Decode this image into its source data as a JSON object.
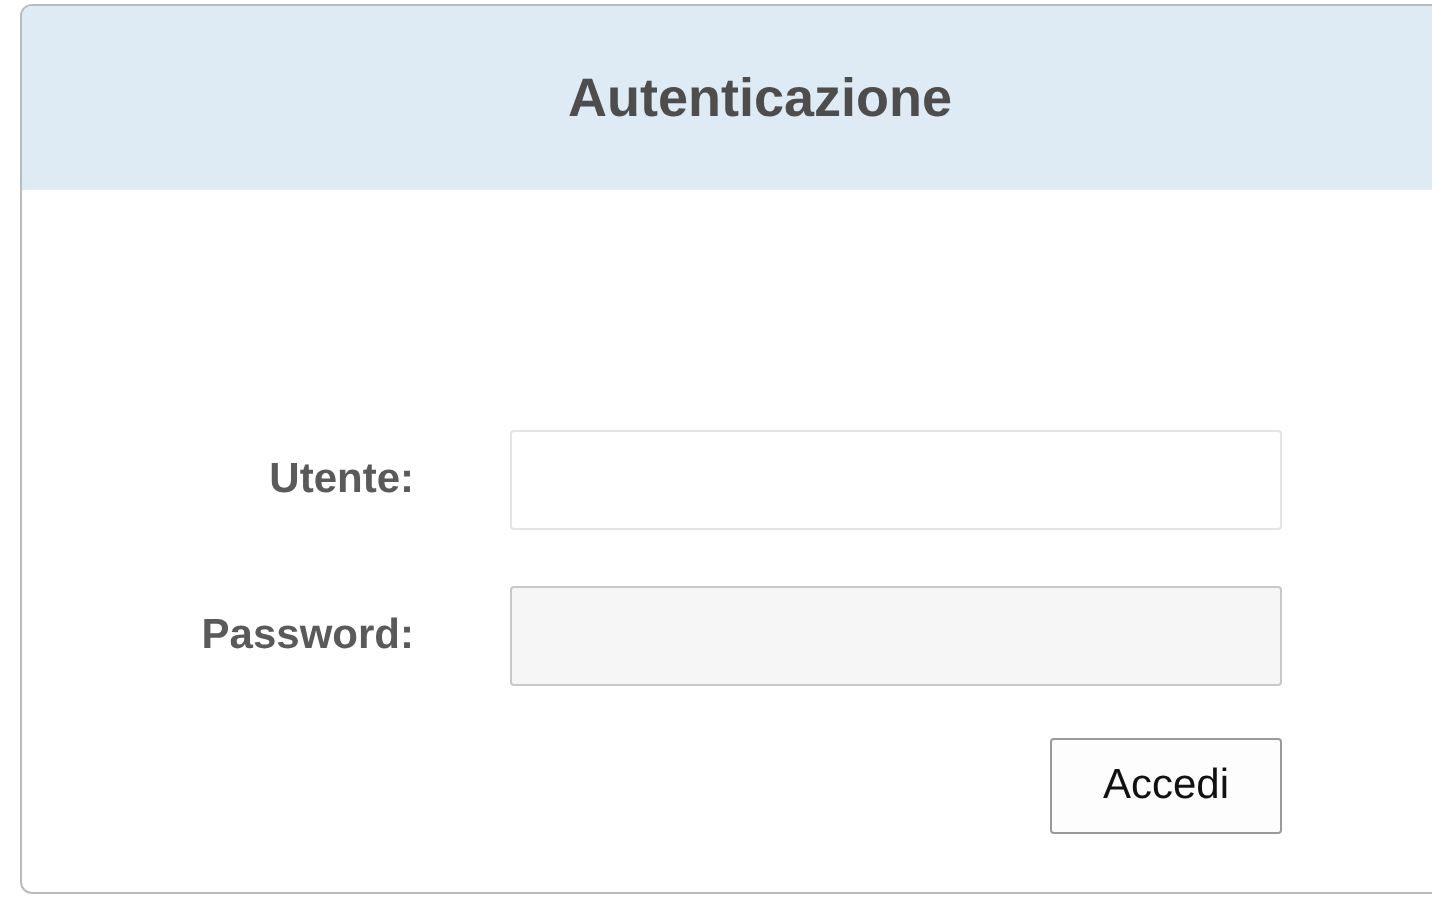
{
  "panel": {
    "title": "Autenticazione"
  },
  "fields": [
    {
      "label": "Utente:",
      "kind": "text"
    },
    {
      "label": "Password:",
      "kind": "password"
    }
  ],
  "button": {
    "label": "Accedi"
  }
}
